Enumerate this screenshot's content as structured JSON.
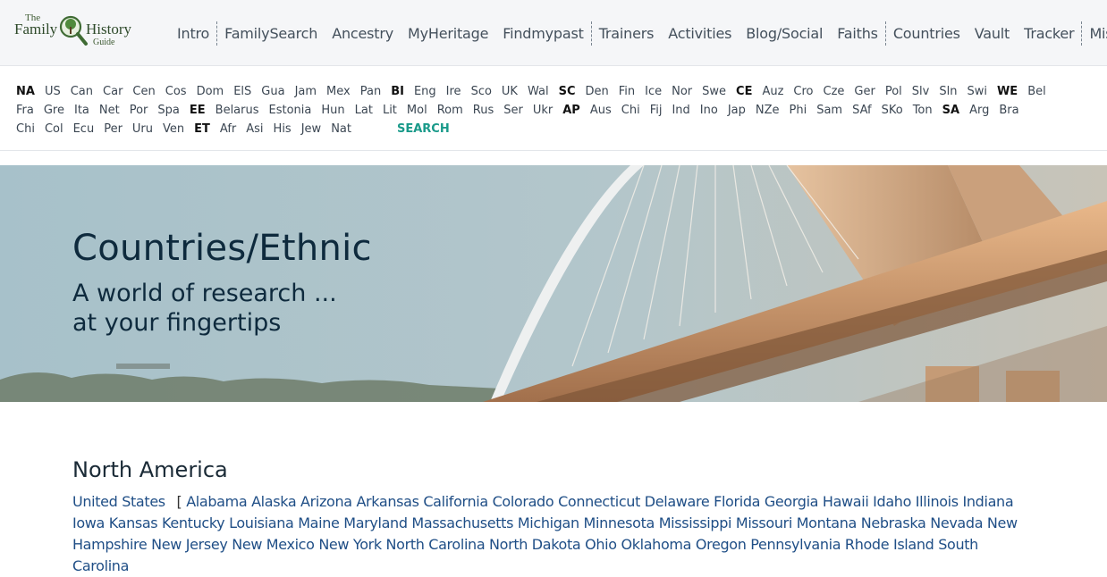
{
  "logo": {
    "the": "The",
    "family": "Family",
    "history": "History",
    "guide": "Guide"
  },
  "nav": {
    "items": [
      {
        "label": "Intro",
        "sep": false
      },
      {
        "label": "FamilySearch",
        "sep": true
      },
      {
        "label": "Ancestry",
        "sep": false
      },
      {
        "label": "MyHeritage",
        "sep": false
      },
      {
        "label": "Findmypast",
        "sep": false
      },
      {
        "label": "Trainers",
        "sep": true
      },
      {
        "label": "Activities",
        "sep": false
      },
      {
        "label": "Blog/Social",
        "sep": false
      },
      {
        "label": "Faiths",
        "sep": false
      },
      {
        "label": "Countries",
        "sep": true
      },
      {
        "label": "Vault",
        "sep": false
      },
      {
        "label": "Tracker",
        "sep": false
      },
      {
        "label": "Misc.",
        "sep": true
      }
    ]
  },
  "codes": {
    "row1": [
      {
        "label": "NA",
        "region": true
      },
      {
        "label": "US"
      },
      {
        "label": "Can"
      },
      {
        "label": "Car"
      },
      {
        "label": "Cen"
      },
      {
        "label": "Cos"
      },
      {
        "label": "Dom"
      },
      {
        "label": "ElS"
      },
      {
        "label": "Gua"
      },
      {
        "label": "Jam"
      },
      {
        "label": "Mex"
      },
      {
        "label": "Pan"
      },
      {
        "label": "BI",
        "region": true
      },
      {
        "label": "Eng"
      },
      {
        "label": "Ire"
      },
      {
        "label": "Sco"
      },
      {
        "label": "UK"
      },
      {
        "label": "Wal"
      },
      {
        "label": "SC",
        "region": true
      },
      {
        "label": "Den"
      },
      {
        "label": "Fin"
      },
      {
        "label": "Ice"
      },
      {
        "label": "Nor"
      },
      {
        "label": "Swe"
      },
      {
        "label": "CE",
        "region": true
      },
      {
        "label": "Auz"
      },
      {
        "label": "Cro"
      },
      {
        "label": "Cze"
      },
      {
        "label": "Ger"
      },
      {
        "label": "Pol"
      },
      {
        "label": "Slv"
      },
      {
        "label": "Sln"
      },
      {
        "label": "Swi"
      },
      {
        "label": "WE",
        "region": true
      },
      {
        "label": "Bel"
      }
    ],
    "row2": [
      {
        "label": "Fra"
      },
      {
        "label": "Gre"
      },
      {
        "label": "Ita"
      },
      {
        "label": "Net"
      },
      {
        "label": "Por"
      },
      {
        "label": "Spa"
      },
      {
        "label": "EE",
        "region": true
      },
      {
        "label": "Belarus"
      },
      {
        "label": "Estonia"
      },
      {
        "label": "Hun"
      },
      {
        "label": "Lat"
      },
      {
        "label": "Lit"
      },
      {
        "label": "Mol"
      },
      {
        "label": "Rom"
      },
      {
        "label": "Rus"
      },
      {
        "label": "Ser"
      },
      {
        "label": "Ukr"
      },
      {
        "label": "AP",
        "region": true
      },
      {
        "label": "Aus"
      },
      {
        "label": "Chi"
      },
      {
        "label": "Fij"
      },
      {
        "label": "Ind"
      },
      {
        "label": "Ino"
      },
      {
        "label": "Jap"
      },
      {
        "label": "NZe"
      },
      {
        "label": "Phi"
      },
      {
        "label": "Sam"
      },
      {
        "label": "SAf"
      },
      {
        "label": "SKo"
      },
      {
        "label": "Ton"
      },
      {
        "label": "SA",
        "region": true
      },
      {
        "label": "Arg"
      },
      {
        "label": "Bra"
      }
    ],
    "row3": [
      {
        "label": "Chi"
      },
      {
        "label": "Col"
      },
      {
        "label": "Ecu"
      },
      {
        "label": "Per"
      },
      {
        "label": "Uru"
      },
      {
        "label": "Ven"
      },
      {
        "label": "ET",
        "region": true
      },
      {
        "label": "Afr"
      },
      {
        "label": "Asi"
      },
      {
        "label": "His"
      },
      {
        "label": "Jew"
      },
      {
        "label": "Nat"
      }
    ],
    "search_label": "SEARCH"
  },
  "hero": {
    "title": "Countries/Ethnic",
    "subtitle_line1": "A world of research ...",
    "subtitle_line2": "at your fingertips"
  },
  "section": {
    "title": "North America",
    "country": "United States",
    "open_bracket": "[",
    "states": [
      "Alabama",
      "Alaska",
      "Arizona",
      "Arkansas",
      "California",
      "Colorado",
      "Connecticut",
      "Delaware",
      "Florida",
      "Georgia",
      "Hawaii",
      "Idaho",
      "Illinois",
      "Indiana",
      "Iowa",
      "Kansas",
      "Kentucky",
      "Louisiana",
      "Maine",
      "Maryland",
      "Massachusetts",
      "Michigan",
      "Minnesota",
      "Mississippi",
      "Missouri",
      "Montana",
      "Nebraska",
      "Nevada",
      "New Hampshire",
      "New Jersey",
      "New Mexico",
      "New York",
      "North Carolina",
      "North Dakota",
      "Ohio",
      "Oklahoma",
      "Oregon",
      "Pennsylvania",
      "Rhode Island",
      "South Carolina"
    ]
  }
}
